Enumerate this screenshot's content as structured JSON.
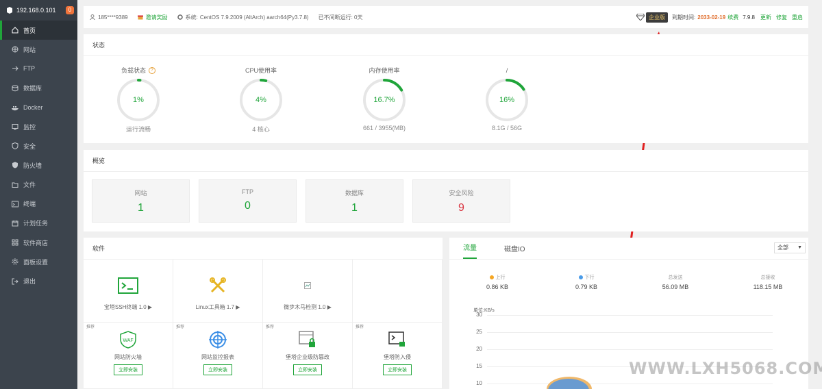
{
  "sidebar": {
    "server_ip": "192.168.0.101",
    "notification_count": "0",
    "items": [
      {
        "label": "首页",
        "icon": "home-icon",
        "active": true
      },
      {
        "label": "网站",
        "icon": "globe-icon"
      },
      {
        "label": "FTP",
        "icon": "ftp-icon"
      },
      {
        "label": "数据库",
        "icon": "database-icon"
      },
      {
        "label": "Docker",
        "icon": "docker-icon"
      },
      {
        "label": "监控",
        "icon": "monitor-icon"
      },
      {
        "label": "安全",
        "icon": "shield-icon"
      },
      {
        "label": "防火墙",
        "icon": "firewall-icon"
      },
      {
        "label": "文件",
        "icon": "folder-icon"
      },
      {
        "label": "终端",
        "icon": "terminal-icon"
      },
      {
        "label": "计划任务",
        "icon": "calendar-icon"
      },
      {
        "label": "软件商店",
        "icon": "grid-icon"
      },
      {
        "label": "面板设置",
        "icon": "gear-icon"
      },
      {
        "label": "退出",
        "icon": "logout-icon"
      }
    ]
  },
  "topbar": {
    "user": "185****9389",
    "invite": "邀请奖励",
    "system_label": "系统:",
    "system": "CentOS 7.9.2009 (AltArch) aarch64(Py3.7.8)",
    "uptime": "已不间断运行: 0天",
    "edition": "企业版",
    "expire_label": "到期时间:",
    "expire_date": "2033-02-19",
    "renew": "续费",
    "version": "7.9.8",
    "update": "更新",
    "repair": "修复",
    "restart": "重启"
  },
  "status": {
    "title": "状态",
    "gauges": [
      {
        "label": "负载状态",
        "value": "1%",
        "sub": "运行流畅",
        "pct": 1,
        "help": "?"
      },
      {
        "label": "CPU使用率",
        "value": "4%",
        "sub": "4 核心",
        "pct": 4
      },
      {
        "label": "内存使用率",
        "value": "16.7%",
        "sub": "661 / 3955(MB)",
        "pct": 16.7
      },
      {
        "label": "/",
        "value": "16%",
        "sub": "8.1G / 56G",
        "pct": 16
      }
    ]
  },
  "overview": {
    "title": "概览",
    "cards": [
      {
        "label": "网站",
        "value": "1"
      },
      {
        "label": "FTP",
        "value": "0"
      },
      {
        "label": "数据库",
        "value": "1"
      },
      {
        "label": "安全风险",
        "value": "9"
      }
    ]
  },
  "software": {
    "title": "软件",
    "row1": [
      {
        "name": "宝塔SSH终端 1.0 ▶",
        "icon": "terminal-icon"
      },
      {
        "name": "Linux工具箱 1.7 ▶",
        "icon": "tools-icon"
      },
      {
        "name": "微步木马检测 1.0 ▶",
        "icon": "broken-image-icon"
      },
      {
        "name": "",
        "icon": ""
      }
    ],
    "row2": [
      {
        "tag": "推荐",
        "name": "网站防火墙",
        "icon": "waf-icon",
        "install": "立即安装"
      },
      {
        "tag": "推荐",
        "name": "网站监控报表",
        "icon": "target-icon",
        "install": "立即安装"
      },
      {
        "tag": "推荐",
        "name": "堡塔企业级防篡改",
        "icon": "window-lock-icon",
        "install": "立即安装"
      },
      {
        "tag": "推荐",
        "name": "堡塔防入侵",
        "icon": "terminal-lock-icon",
        "install": "立即安装"
      }
    ]
  },
  "traffic": {
    "tabs": [
      "流量",
      "磁盘IO"
    ],
    "select": "全部",
    "stats": [
      {
        "label": "上行",
        "value": "0.86 KB",
        "dot": "#f5a623"
      },
      {
        "label": "下行",
        "value": "0.79 KB",
        "dot": "#4a9be8"
      },
      {
        "label": "总发送",
        "value": "56.09 MB"
      },
      {
        "label": "总接收",
        "value": "118.15 MB"
      }
    ],
    "unit": "单位:KB/s",
    "yticks": [
      "30",
      "25",
      "20",
      "15",
      "10"
    ]
  },
  "watermark": "WWW.LXH5068.COM",
  "colors": {
    "accent": "#20a53a",
    "danger": "#d9333f",
    "sidebar": "#3c444d",
    "expire": "#e06c2a"
  }
}
